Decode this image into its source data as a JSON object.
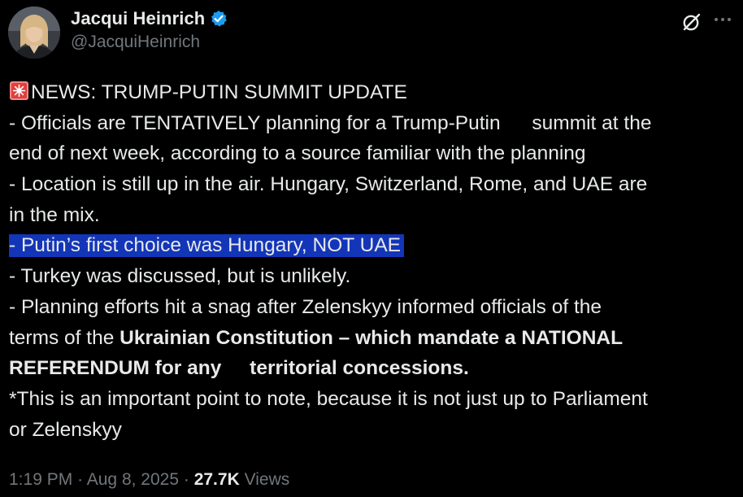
{
  "author": {
    "display_name": "Jacqui Heinrich",
    "handle": "@JacquiHeinrich",
    "verified": true
  },
  "icons": {
    "verified": "verified-badge-icon",
    "grok": "grok-icon",
    "more": "more-options-icon",
    "siren": "rotating-light-emoji"
  },
  "colors": {
    "background": "#000000",
    "text": "#e7e9ea",
    "muted": "#71767b",
    "verified": "#1d9bf0",
    "highlight": "#1335b8"
  },
  "tweet": {
    "headline": "NEWS: TRUMP-PUTIN SUMMIT UPDATE",
    "l2a": "- Officials are TENTATIVELY planning for a Trump-Putin",
    "l2b": "summit at the",
    "l3": "end of next week, according to a source familiar with the planning",
    "l4": "- Location is still up in the air. Hungary, Switzerland, Rome, and UAE are",
    "l5": "in the mix.",
    "l6": "- Putin’s first choice was Hungary, NOT UAE",
    "l7": "- Turkey was discussed, but is unlikely.",
    "l8": "- Planning efforts hit a snag after Zelenskyy informed officials of the",
    "l9_plain": "terms of the ",
    "l9_bold": "Ukrainian Constitution – which mandate a NATIONAL",
    "l10a": "REFERENDUM for any",
    "l10b": "territorial concessions.",
    "l11": "*This is an important point to note, because it is not just up to Parliament",
    "l12": "or  Zelenskyy"
  },
  "meta": {
    "time": "1:19 PM",
    "separator": "·",
    "date": "Aug 8, 2025",
    "views_count": "27.7K",
    "views_label": "Views"
  }
}
